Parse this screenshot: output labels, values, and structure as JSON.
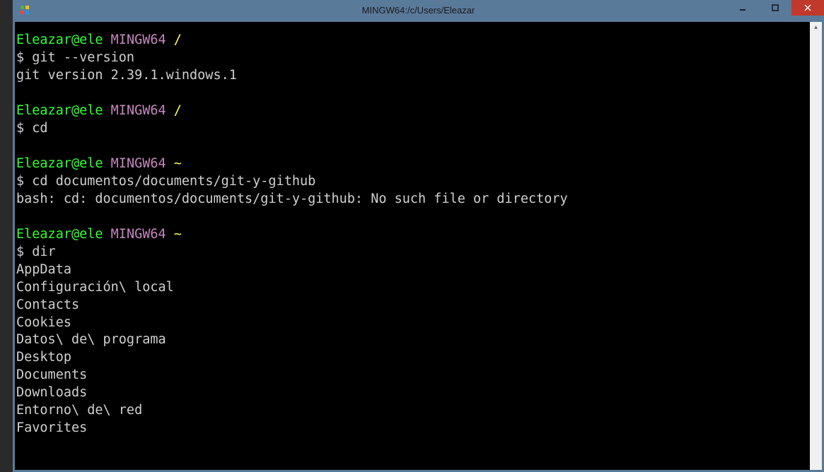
{
  "window": {
    "title": "MINGW64:/c/Users/Eleazar"
  },
  "terminal": {
    "blocks": [
      {
        "user": "Eleazar@ele",
        "host": "MINGW64",
        "path": "/",
        "command": "git --version",
        "output": [
          "git version 2.39.1.windows.1"
        ]
      },
      {
        "user": "Eleazar@ele",
        "host": "MINGW64",
        "path": "/",
        "command": "cd",
        "output": []
      },
      {
        "user": "Eleazar@ele",
        "host": "MINGW64",
        "path": "~",
        "command": "cd documentos/documents/git-y-github",
        "output": [
          "bash: cd: documentos/documents/git-y-github: No such file or directory"
        ]
      },
      {
        "user": "Eleazar@ele",
        "host": "MINGW64",
        "path": "~",
        "command": "dir",
        "output": [
          "AppData",
          "Configuración\\ local",
          "Contacts",
          "Cookies",
          "Datos\\ de\\ programa",
          "Desktop",
          "Documents",
          "Downloads",
          "Entorno\\ de\\ red",
          "Favorites"
        ]
      }
    ]
  }
}
